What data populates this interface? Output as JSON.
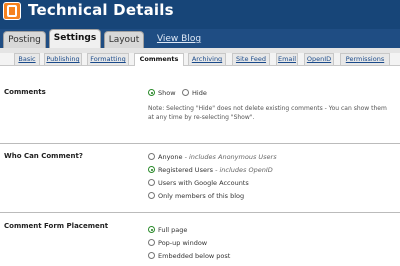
{
  "app": {
    "title": "Technical Details"
  },
  "main_tabs": [
    {
      "label": "Posting",
      "active": false
    },
    {
      "label": "Settings",
      "active": true
    },
    {
      "label": "Layout",
      "active": false
    },
    {
      "label": "View Blog",
      "active": false
    }
  ],
  "sub_tabs": [
    {
      "label": "Basic",
      "active": false
    },
    {
      "label": "Publishing",
      "active": false
    },
    {
      "label": "Formatting",
      "active": false
    },
    {
      "label": "Comments",
      "active": true
    },
    {
      "label": "Archiving",
      "active": false
    },
    {
      "label": "Site Feed",
      "active": false
    },
    {
      "label": "Email",
      "active": false
    },
    {
      "label": "OpenID",
      "active": false
    },
    {
      "label": "Permissions",
      "active": false
    }
  ],
  "comments": {
    "label": "Comments",
    "options": [
      {
        "label": "Show",
        "selected": true
      },
      {
        "label": "Hide",
        "selected": false
      }
    ],
    "note": "Note: Selecting \"Hide\" does not delete existing comments - You can show them at any time by re-selecting \"Show\"."
  },
  "who_can_comment": {
    "label": "Who Can Comment?",
    "options": [
      {
        "label": "Anyone",
        "hint": "- includes Anonymous Users",
        "selected": false
      },
      {
        "label": "Registered Users",
        "hint": "- includes OpenID",
        "selected": true
      },
      {
        "label": "Users with Google Accounts",
        "hint": "",
        "selected": false
      },
      {
        "label": "Only members of this blog",
        "hint": "",
        "selected": false
      }
    ]
  },
  "form_placement": {
    "label": "Comment Form Placement",
    "options": [
      {
        "label": "Full page",
        "selected": true
      },
      {
        "label": "Pop-up window",
        "selected": false
      },
      {
        "label": "Embedded below post",
        "selected": false
      }
    ]
  },
  "icons": {
    "logo": "blogger-logo-icon"
  },
  "colors": {
    "header": "#1f4d83",
    "blogger_orange": "#f6821f",
    "selected_radio": "#1a7a1a"
  }
}
